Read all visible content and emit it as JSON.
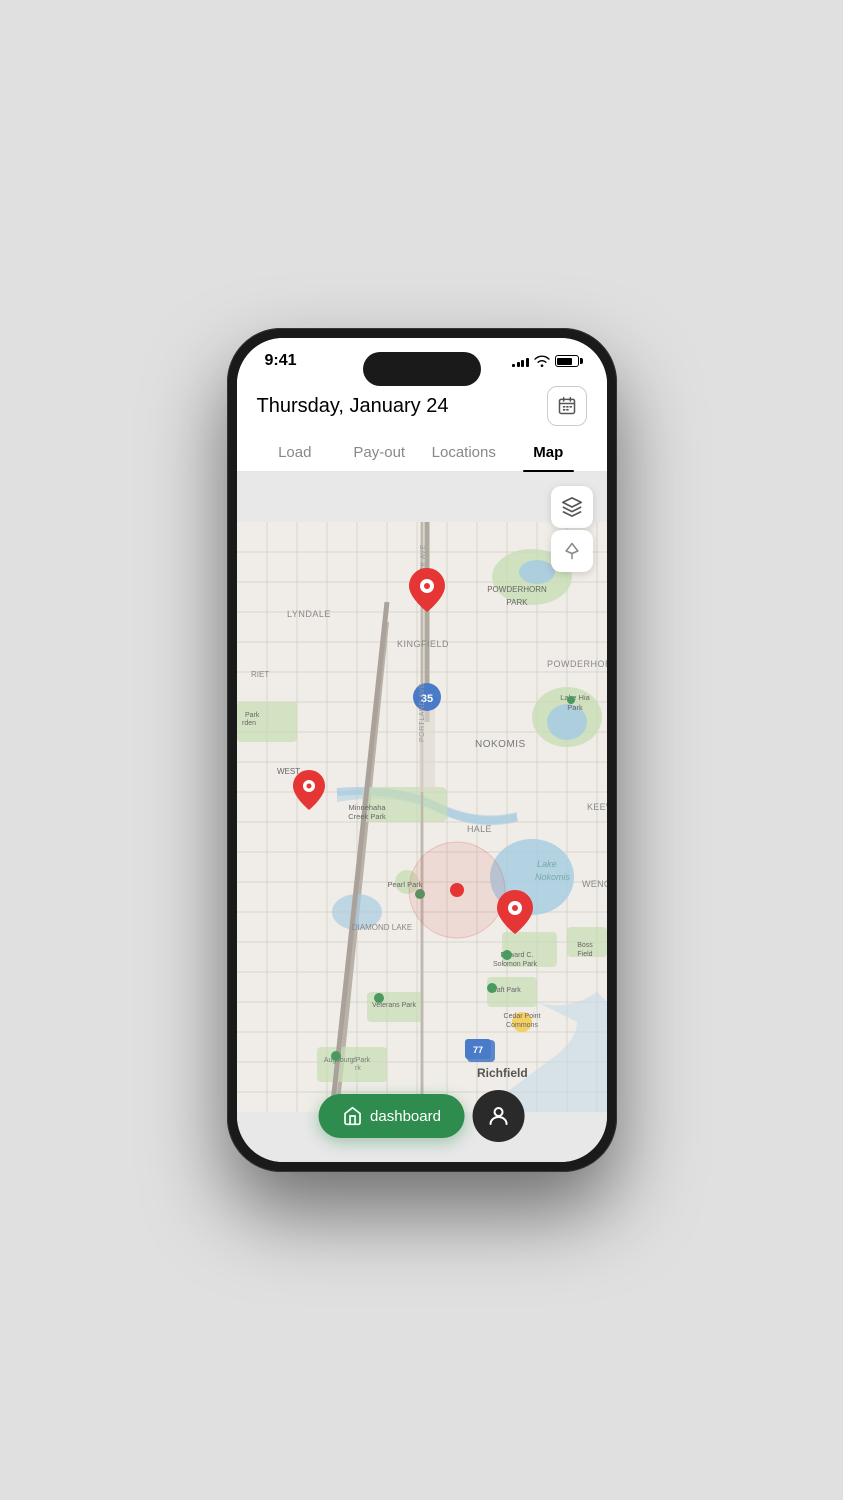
{
  "status": {
    "time": "9:41",
    "signal_bars": [
      3,
      5,
      7,
      9,
      11
    ],
    "battery_level": 80
  },
  "header": {
    "date": "Thursday, January 24",
    "calendar_icon": "calendar-icon"
  },
  "tabs": [
    {
      "id": "load",
      "label": "Load",
      "active": false
    },
    {
      "id": "payout",
      "label": "Pay-out",
      "active": false
    },
    {
      "id": "locations",
      "label": "Locations",
      "active": false
    },
    {
      "id": "map",
      "label": "Map",
      "active": true
    }
  ],
  "map": {
    "map_layers_icon": "map-layers-icon",
    "navigation_icon": "navigation-icon"
  },
  "bottom_nav": {
    "dashboard_label": "dashboard",
    "dashboard_icon": "home-icon",
    "profile_icon": "profile-icon"
  }
}
